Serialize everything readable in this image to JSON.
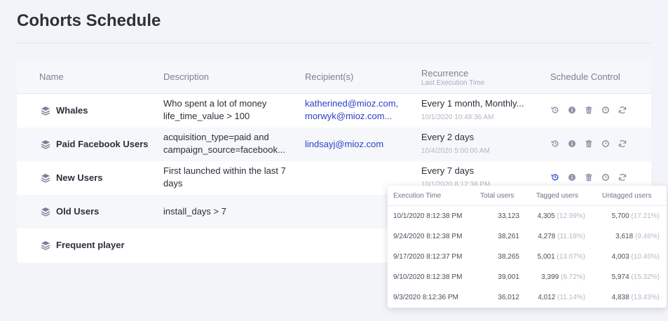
{
  "page": {
    "title": "Cohorts Schedule"
  },
  "table": {
    "headers": {
      "name": "Name",
      "description": "Description",
      "recipients": "Recipient(s)",
      "recurrence": "Recurrence",
      "recurrence_sub": "Last Execution Time",
      "control": "Schedule Control"
    },
    "rows": [
      {
        "name": "Whales",
        "description": "Who spent a lot of money life_time_value > 100",
        "recipients": [
          "katherined@mioz.com,",
          "morwyk@mioz.com..."
        ],
        "recurrence": "Every 1 month, Monthly...",
        "last_run": "10/1/2020  10:48:36 AM"
      },
      {
        "name": "Paid Facebook Users",
        "description": "acquisition_type=paid and campaign_source=facebook...",
        "recipients": [
          "lindsayj@mioz.com"
        ],
        "recurrence": "Every 2 days",
        "last_run": "10/4/2020  5:00:00 AM"
      },
      {
        "name": "New Users",
        "description": "First launched within the last 7 days",
        "recipients": [],
        "recurrence": "Every 7 days",
        "last_run": "10/1/2020  8:12:38 PM"
      },
      {
        "name": "Old Users",
        "description": "install_days > 7",
        "recipients": [],
        "recurrence": "",
        "last_run": ""
      },
      {
        "name": "Frequent player",
        "description": "",
        "recipients": [],
        "recurrence": "",
        "last_run": ""
      }
    ],
    "controls": [
      "history-icon",
      "info-icon",
      "trash-icon",
      "schedule-icon",
      "refresh-icon"
    ]
  },
  "history_popup": {
    "headers": {
      "time": "Execution Time",
      "total": "Total users",
      "tagged": "Tagged users",
      "untagged": "Untagged users"
    },
    "rows": [
      {
        "time": "10/1/2020  8:12:38 PM",
        "total": "33,123",
        "tagged": "4,305",
        "tagged_pct": "(12.99%)",
        "untagged": "5,700",
        "untagged_pct": "(17.21%)"
      },
      {
        "time": "9/24/2020  8:12:38 PM",
        "total": "38,261",
        "tagged": "4,278",
        "tagged_pct": "(11.18%)",
        "untagged": "3,618",
        "untagged_pct": "(9.46%)"
      },
      {
        "time": "9/17/2020  8:12:37 PM",
        "total": "38,265",
        "tagged": "5,001",
        "tagged_pct": "(13.07%)",
        "untagged": "4,003",
        "untagged_pct": "(10.46%)"
      },
      {
        "time": "9/10/2020  8:12:38 PM",
        "total": "39,001",
        "tagged": "3,399",
        "tagged_pct": "(8.72%)",
        "untagged": "5,974",
        "untagged_pct": "(15.32%)"
      },
      {
        "time": "9/3/2020  8:12:36 PM",
        "total": "36,012",
        "tagged": "4,012",
        "tagged_pct": "(11.14%)",
        "untagged": "4,838",
        "untagged_pct": "(13.43%)"
      }
    ]
  },
  "colors": {
    "accent": "#2b40c8",
    "active_icon": "#3451d1",
    "icon": "#8e93a8"
  }
}
